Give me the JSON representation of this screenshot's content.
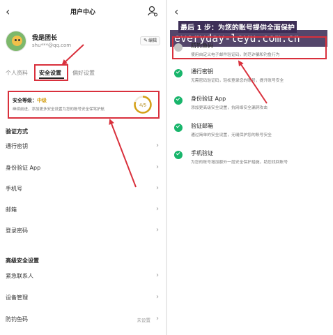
{
  "left": {
    "header": {
      "back": "‹",
      "title": "用户中心"
    },
    "profile": {
      "username": "我是团长",
      "email": "shu***@qq.com",
      "edit_label": "编辑"
    },
    "tabs": [
      "个人资料",
      "安全设置",
      "偏好设置"
    ],
    "security": {
      "label": "安全等级：",
      "level": "中级",
      "desc": "继续前进，添加更多安全设置为您的账号安全保驾护航",
      "score": "4/5"
    },
    "verify_title": "验证方式",
    "verify_items": [
      {
        "label": "通行密钥",
        "value": ""
      },
      {
        "label": "身份验证 App",
        "value": ""
      },
      {
        "label": "手机号",
        "value": ""
      },
      {
        "label": "邮箱",
        "value": ""
      },
      {
        "label": "登录密码",
        "value": ""
      }
    ],
    "advanced_title": "高级安全设置",
    "advanced_items": [
      {
        "label": "紧急联系人",
        "value": ""
      },
      {
        "label": "设备管理",
        "value": ""
      },
      {
        "label": "防钓鱼码",
        "value": "未设置"
      }
    ]
  },
  "right": {
    "back": "‹",
    "step_title": "最后 1 步：为您的账号提供全面保护",
    "watermark": "everyday-leyu.com.cn",
    "items": [
      {
        "name": "防钓鱼码",
        "desc": "使用自定义电子邮件验证码，防范诈骗和钓鱼行为",
        "done": false
      },
      {
        "name": "通行密钥",
        "desc": "无需密码验证码，轻松登录您的账号，提升账号安全",
        "done": true
      },
      {
        "name": "身份验证 App",
        "desc": "添加更高级安全设置，抗网络安全漏洞攻击",
        "done": true
      },
      {
        "name": "验证邮箱",
        "desc": "通过简单的安全设置，无缝保护您的账号安全",
        "done": true
      },
      {
        "name": "手机验证",
        "desc": "为您的账号增加额外一层安全保护措施，助您找回账号",
        "done": true
      }
    ]
  },
  "colors": {
    "highlight": "#d9303c",
    "success": "#18b56b",
    "level": "#d4a017",
    "watermark_bg": "#3c2c56"
  }
}
